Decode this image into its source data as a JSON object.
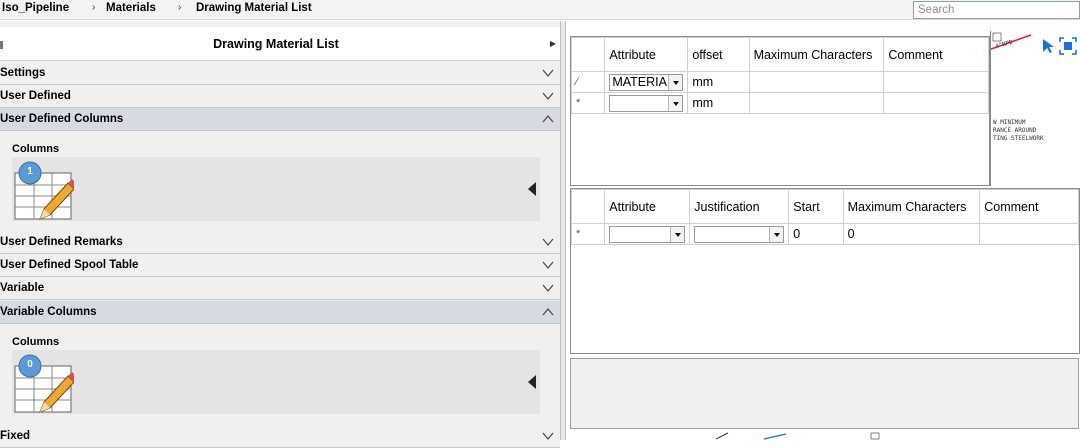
{
  "breadcrumb": {
    "items": [
      "Iso_Pipeline",
      "Materials",
      "Drawing Material List"
    ]
  },
  "search": {
    "placeholder": "Search"
  },
  "left_panel": {
    "title": "Drawing Material List",
    "sections": [
      {
        "label": "Settings",
        "expanded": false
      },
      {
        "label": "User Defined",
        "expanded": false
      },
      {
        "label": "User Defined Columns",
        "expanded": true
      },
      {
        "label": "User Defined Remarks",
        "expanded": false
      },
      {
        "label": "User Defined Spool Table",
        "expanded": false
      },
      {
        "label": "Variable",
        "expanded": false
      },
      {
        "label": "Variable Columns",
        "expanded": true
      },
      {
        "label": "Fixed",
        "expanded": false
      }
    ],
    "user_defined_columns": {
      "title": "Columns",
      "count": "1"
    },
    "variable_columns": {
      "title": "Columns",
      "count": "0"
    }
  },
  "grid1": {
    "headers": [
      "Attribute",
      "offset",
      "Maximum Characters",
      "Comment"
    ],
    "rows": [
      {
        "marker": "∕",
        "attribute": "MATERIAL",
        "offset": "mm",
        "max": "",
        "comment": ""
      },
      {
        "marker": "*",
        "attribute": "",
        "offset": "mm",
        "max": "",
        "comment": ""
      }
    ]
  },
  "grid2": {
    "headers": [
      "Attribute",
      "Justification",
      "Start",
      "Maximum Characters",
      "Comment"
    ],
    "rows": [
      {
        "marker": "*",
        "attribute": "",
        "justification": "",
        "start": "0",
        "max": "0",
        "comment": ""
      }
    ]
  },
  "drawing": {
    "lines": [
      "W MINIMUM",
      "RANCE AROUND",
      "TING STEELWORK"
    ],
    "label": "4\"NPD"
  },
  "colors": {
    "accent_blue": "#1e6fd9",
    "badge_blue": "#5b9bd5",
    "section_open": "#d6dbe3"
  }
}
